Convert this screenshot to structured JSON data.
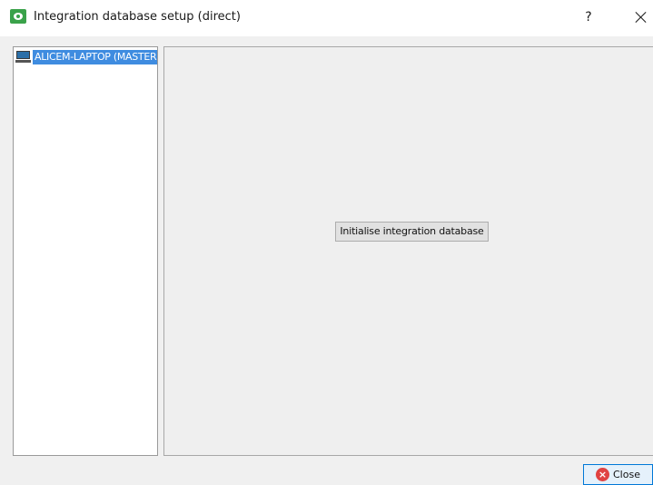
{
  "window": {
    "title": "Integration database setup (direct)",
    "help_label": "?",
    "close_glyph": "×"
  },
  "tree": {
    "items": [
      {
        "label": "ALICEM-LAPTOP (MASTER)",
        "icon": "computer-icon",
        "selected": true
      }
    ]
  },
  "content": {
    "init_button_label": "Initialise integration database"
  },
  "footer": {
    "close_label": "Close",
    "close_icon_glyph": "×"
  },
  "colors": {
    "app_icon": "#3aa24a",
    "selection": "#3f8ce0",
    "close_icon": "#e04343",
    "focus_border": "#0078d7"
  }
}
